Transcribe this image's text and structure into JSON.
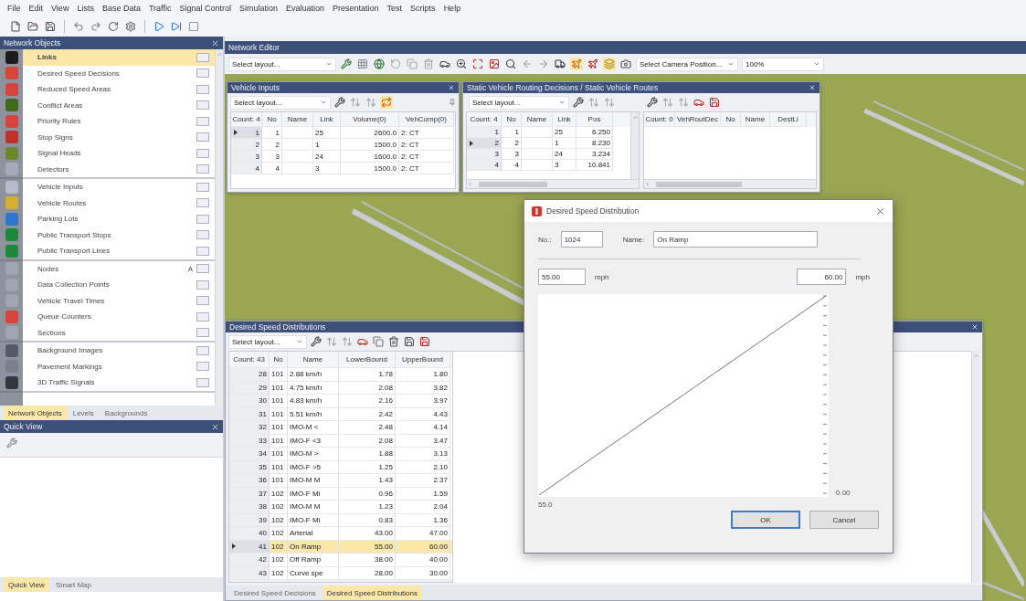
{
  "menu": [
    "File",
    "Edit",
    "View",
    "Lists",
    "Base Data",
    "Traffic",
    "Signal Control",
    "Simulation",
    "Evaluation",
    "Presentation",
    "Test",
    "Scripts",
    "Help"
  ],
  "network_objects": {
    "title": "Network Objects",
    "groups": [
      {
        "items": [
          {
            "label": "Links",
            "color": "#1c1c1c",
            "selected": true
          },
          {
            "label": "Desired Speed Decisions",
            "color": "#d8443c",
            "selected": false
          },
          {
            "label": "Reduced Speed Areas",
            "color": "#d8443c",
            "selected": false
          },
          {
            "label": "Conflict Areas",
            "color": "#3f6a1c",
            "selected": false
          },
          {
            "label": "Priority Rules",
            "color": "#d8443c",
            "selected": false
          },
          {
            "label": "Stop Signs",
            "color": "#c0302a",
            "selected": false
          },
          {
            "label": "Signal Heads",
            "color": "#6a8a2a",
            "selected": false
          },
          {
            "label": "Detectors",
            "color": "#a4aab8",
            "selected": false
          }
        ]
      },
      {
        "items": [
          {
            "label": "Vehicle Inputs",
            "color": "#b4bccb",
            "selected": false
          },
          {
            "label": "Vehicle Routes",
            "color": "#d6b02a",
            "selected": false
          },
          {
            "label": "Parking Lots",
            "color": "#2a78d0",
            "selected": false
          },
          {
            "label": "Public Transport Stops",
            "color": "#1a8a3a",
            "selected": false
          },
          {
            "label": "Public Transport Lines",
            "color": "#1a8a3a",
            "selected": false
          }
        ]
      },
      {
        "items": [
          {
            "label": "Nodes",
            "color": "#a0a6b0",
            "selected": false,
            "marker": "A"
          },
          {
            "label": "Data Collection Points",
            "color": "#a0a6b0",
            "selected": false
          },
          {
            "label": "Vehicle Travel Times",
            "color": "#a0a6b0",
            "selected": false
          },
          {
            "label": "Queue Counters",
            "color": "#d8443c",
            "selected": false
          },
          {
            "label": "Sections",
            "color": "#a0a6b0",
            "selected": false
          }
        ]
      },
      {
        "items": [
          {
            "label": "Background Images",
            "color": "#555a66",
            "selected": false
          },
          {
            "label": "Pavement Markings",
            "color": "#7a808c",
            "selected": false
          },
          {
            "label": "3D Traffic Signals",
            "color": "#333740",
            "selected": false
          }
        ]
      }
    ],
    "tabs": [
      {
        "label": "Network Objects",
        "selected": true
      },
      {
        "label": "Levels",
        "selected": false
      },
      {
        "label": "Backgrounds",
        "selected": false
      }
    ]
  },
  "quick_view": {
    "title": "Quick View",
    "tabs": [
      {
        "label": "Quick View",
        "selected": true
      },
      {
        "label": "Smart Map",
        "selected": false
      }
    ]
  },
  "network_editor": {
    "title": "Network Editor",
    "layout_select": "Select layout...",
    "camera_select": "Select Camera Position...",
    "zoom_select": "100%"
  },
  "vehicle_inputs": {
    "title": "Vehicle Inputs",
    "layout_select": "Select layout...",
    "table": {
      "columns": [
        "Count: 4",
        "No",
        "Name",
        "Link",
        "Volume(0)",
        "VehComp(0)"
      ],
      "rows": [
        {
          "current": true,
          "selected": false,
          "cells": [
            "1",
            "1",
            "",
            "25",
            "2600.0",
            "2: CT"
          ]
        },
        {
          "current": false,
          "selected": false,
          "cells": [
            "2",
            "2",
            "",
            "1",
            "1500.0",
            "2: CT"
          ]
        },
        {
          "current": false,
          "selected": false,
          "cells": [
            "3",
            "3",
            "",
            "24",
            "1600.0",
            "2: CT"
          ]
        },
        {
          "current": false,
          "selected": false,
          "cells": [
            "4",
            "4",
            "",
            "3",
            "1500.0",
            "2: CT"
          ]
        }
      ]
    }
  },
  "static_routing": {
    "title": "Static Vehicle Routing Decisions / Static Vehicle Routes",
    "layout_select": "Select layout...",
    "table": {
      "columns": [
        "Count: 4",
        "No",
        "Name",
        "Link",
        "Pos"
      ],
      "rows": [
        {
          "current": false,
          "selected": false,
          "cells": [
            "1",
            "1",
            "",
            "25",
            "6.250"
          ]
        },
        {
          "current": true,
          "selected": false,
          "cells": [
            "2",
            "2",
            "",
            "1",
            "8.230"
          ]
        },
        {
          "current": false,
          "selected": false,
          "cells": [
            "3",
            "3",
            "",
            "24",
            "3.234"
          ]
        },
        {
          "current": false,
          "selected": false,
          "cells": [
            "4",
            "4",
            "",
            "3",
            "10.841"
          ]
        }
      ]
    },
    "routes_table": {
      "columns": [
        "Count: 0",
        "VehRoutDec",
        "No",
        "Name",
        "DestLi"
      ]
    }
  },
  "speed_distributions": {
    "title": "Desired Speed Distributions",
    "layout_select": "Select layout...",
    "table": {
      "columns": [
        "Count: 43",
        "No",
        "Name",
        "LowerBound",
        "UpperBound"
      ],
      "rows": [
        {
          "current": false,
          "selected": false,
          "cells": [
            "28",
            "101",
            "2.88 km/h",
            "1.78",
            "1.80"
          ]
        },
        {
          "current": false,
          "selected": false,
          "cells": [
            "29",
            "101",
            "4.75 km/h",
            "2.08",
            "3.82"
          ]
        },
        {
          "current": false,
          "selected": false,
          "cells": [
            "30",
            "101",
            "4.83 km/h",
            "2.16",
            "3.97"
          ]
        },
        {
          "current": false,
          "selected": false,
          "cells": [
            "31",
            "101",
            "5.51 km/h",
            "2.42",
            "4.43"
          ]
        },
        {
          "current": false,
          "selected": false,
          "cells": [
            "32",
            "101",
            "IMO-M <",
            "2.48",
            "4.14"
          ]
        },
        {
          "current": false,
          "selected": false,
          "cells": [
            "33",
            "101",
            "IMO-F <3",
            "2.08",
            "3.47"
          ]
        },
        {
          "current": false,
          "selected": false,
          "cells": [
            "34",
            "101",
            "IMO-M >",
            "1.88",
            "3.13"
          ]
        },
        {
          "current": false,
          "selected": false,
          "cells": [
            "35",
            "101",
            "IMO-F >5",
            "1.25",
            "2.10"
          ]
        },
        {
          "current": false,
          "selected": false,
          "cells": [
            "36",
            "101",
            "IMO-M M",
            "1.43",
            "2.37"
          ]
        },
        {
          "current": false,
          "selected": false,
          "cells": [
            "37",
            "102",
            "IMO-F Mi",
            "0.96",
            "1.59"
          ]
        },
        {
          "current": false,
          "selected": false,
          "cells": [
            "38",
            "102",
            "IMO-M M",
            "1.23",
            "2.04"
          ]
        },
        {
          "current": false,
          "selected": false,
          "cells": [
            "39",
            "102",
            "IMO-F Mi",
            "0.83",
            "1.36"
          ]
        },
        {
          "current": false,
          "selected": false,
          "cells": [
            "40",
            "102",
            "Arterial",
            "43.00",
            "47.00"
          ]
        },
        {
          "current": true,
          "selected": true,
          "cells": [
            "41",
            "102",
            "On Ramp",
            "55.00",
            "60.00"
          ]
        },
        {
          "current": false,
          "selected": false,
          "cells": [
            "42",
            "102",
            "Off Ramp",
            "38.00",
            "40.00"
          ]
        },
        {
          "current": false,
          "selected": false,
          "cells": [
            "43",
            "102",
            "Curve spe",
            "28.00",
            "30.00"
          ]
        }
      ]
    },
    "tabs": [
      {
        "label": "Desired Speed Decisions",
        "selected": false
      },
      {
        "label": "Desired Speed Distributions",
        "selected": true
      }
    ]
  },
  "dialog": {
    "title": "Desired Speed Distribution",
    "no_label": "No.:",
    "no_value": "1024",
    "name_label": "Name:",
    "name_value": "On Ramp",
    "lower_value": "55.00",
    "lower_unit": "mph",
    "upper_value": "60.00",
    "upper_unit": "mph",
    "x_label": "55.0",
    "y_label": "0.00",
    "buttons": [
      {
        "label": "OK",
        "kind": "default"
      },
      {
        "label": "Cancel",
        "kind": "normal"
      }
    ]
  }
}
